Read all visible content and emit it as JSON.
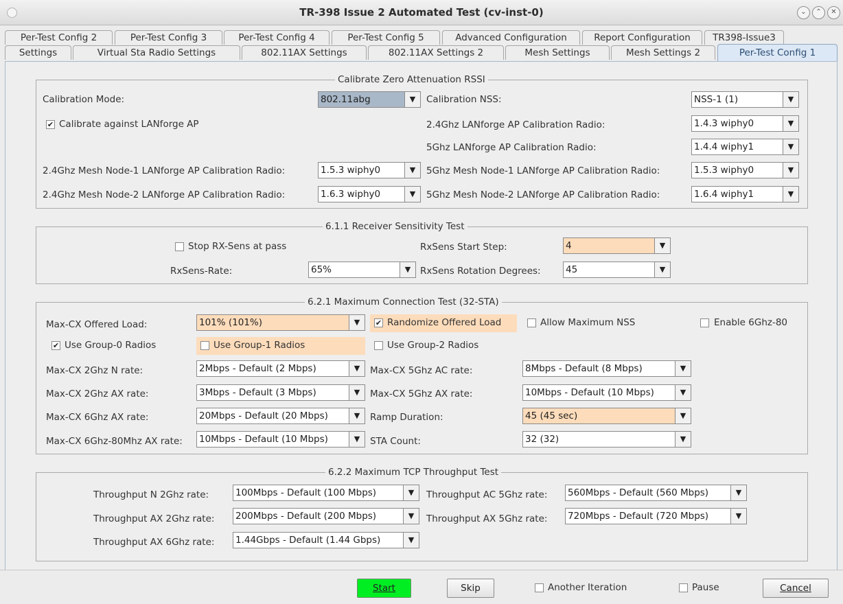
{
  "window": {
    "title": "TR-398 Issue 2 Automated Test  (cv-inst-0)",
    "buttons": [
      "⌄",
      "⌃",
      "✕"
    ]
  },
  "tabs": {
    "row1": [
      "Per-Test Config 2",
      "Per-Test Config 3",
      "Per-Test Config 4",
      "Per-Test Config 5",
      "Advanced Configuration",
      "Report Configuration",
      "TR398-Issue3"
    ],
    "row2": [
      "Settings",
      "Virtual Sta Radio Settings",
      "802.11AX Settings",
      "802.11AX Settings 2",
      "Mesh Settings",
      "Mesh Settings 2",
      "Per-Test Config 1"
    ]
  },
  "calibrate": {
    "title": "Calibrate Zero Attenuation RSSI",
    "mode_label": "Calibration Mode:",
    "mode_value": "802.11abg",
    "nss_label": "Calibration NSS:",
    "nss_value": "NSS-1 (1)",
    "against_ap_label": "Calibrate against LANforge AP",
    "against_ap_checked": "✔",
    "r24_label": "2.4Ghz LANforge AP Calibration Radio:",
    "r24_value": "1.4.3 wiphy0",
    "r5_label": "5Ghz LANforge AP Calibration Radio:",
    "r5_value": "1.4.4 wiphy1",
    "mesh1_24_label": "2.4Ghz Mesh Node-1 LANforge AP Calibration Radio:",
    "mesh1_24_value": "1.5.3 wiphy0",
    "mesh1_5_label": "5Ghz Mesh Node-1 LANforge AP Calibration Radio:",
    "mesh1_5_value": "1.5.3 wiphy0",
    "mesh2_24_label": "2.4Ghz Mesh Node-2 LANforge AP Calibration Radio:",
    "mesh2_24_value": "1.6.3 wiphy0",
    "mesh2_5_label": "5Ghz Mesh Node-2 LANforge AP Calibration Radio:",
    "mesh2_5_value": "1.6.4 wiphy1"
  },
  "rxsens": {
    "title": "6.1.1 Receiver Sensitivity Test",
    "stop_label": "Stop RX-Sens at pass",
    "start_step_label": "RxSens Start Step:",
    "start_step_value": "4",
    "rate_label": "RxSens-Rate:",
    "rate_value": "65%",
    "rotation_label": "RxSens Rotation Degrees:",
    "rotation_value": "45"
  },
  "maxcx": {
    "title": "6.2.1 Maximum Connection Test (32-STA)",
    "offered_label": "Max-CX Offered Load:",
    "offered_value": "101% (101%)",
    "randomize_label": "Randomize Offered Load",
    "randomize_checked": "✔",
    "allow_nss_label": "Allow Maximum NSS",
    "enable_6g80_label": "Enable 6Ghz-80",
    "group0_label": "Use Group-0 Radios",
    "group0_checked": "✔",
    "group1_label": "Use Group-1 Radios",
    "group2_label": "Use Group-2 Radios",
    "n2_label": "Max-CX 2Ghz N rate:",
    "n2_value": "2Mbps - Default (2 Mbps)",
    "ac5_label": "Max-CX 5Ghz AC rate:",
    "ac5_value": "8Mbps - Default (8 Mbps)",
    "ax2_label": "Max-CX 2Ghz AX rate:",
    "ax2_value": "3Mbps - Default (3 Mbps)",
    "ax5_label": "Max-CX 5Ghz AX rate:",
    "ax5_value": "10Mbps - Default (10 Mbps)",
    "ax6_label": "Max-CX 6Ghz AX rate:",
    "ax6_value": "20Mbps - Default (20 Mbps)",
    "ramp_label": "Ramp Duration:",
    "ramp_value": "45 (45 sec)",
    "ax6_80_label": "Max-CX 6Ghz-80Mhz AX rate:",
    "ax6_80_value": "10Mbps - Default (10 Mbps)",
    "sta_label": "STA Count:",
    "sta_value": "32 (32)"
  },
  "tcp": {
    "title": "6.2.2 Maximum TCP Throughput Test",
    "n2_label": "Throughput N 2Ghz rate:",
    "n2_value": "100Mbps - Default (100 Mbps)",
    "ac5_label": "Throughput AC 5Ghz rate:",
    "ac5_value": "560Mbps - Default (560 Mbps)",
    "ax2_label": "Throughput AX 2Ghz rate:",
    "ax2_value": "200Mbps - Default (200 Mbps)",
    "ax5_label": "Throughput AX 5Ghz rate:",
    "ax5_value": "720Mbps - Default (720 Mbps)",
    "ax6_label": "Throughput AX 6Ghz rate:",
    "ax6_value": "1.44Gbps - Default (1.44 Gbps)"
  },
  "footer": {
    "start_label": "Start",
    "skip_label": "Skip",
    "another_label": "Another Iteration",
    "pause_label": "Pause",
    "cancel_label": "Cancel"
  },
  "icons": {
    "dropdown_arrow": "▼",
    "checkbox_mark": "✔"
  }
}
